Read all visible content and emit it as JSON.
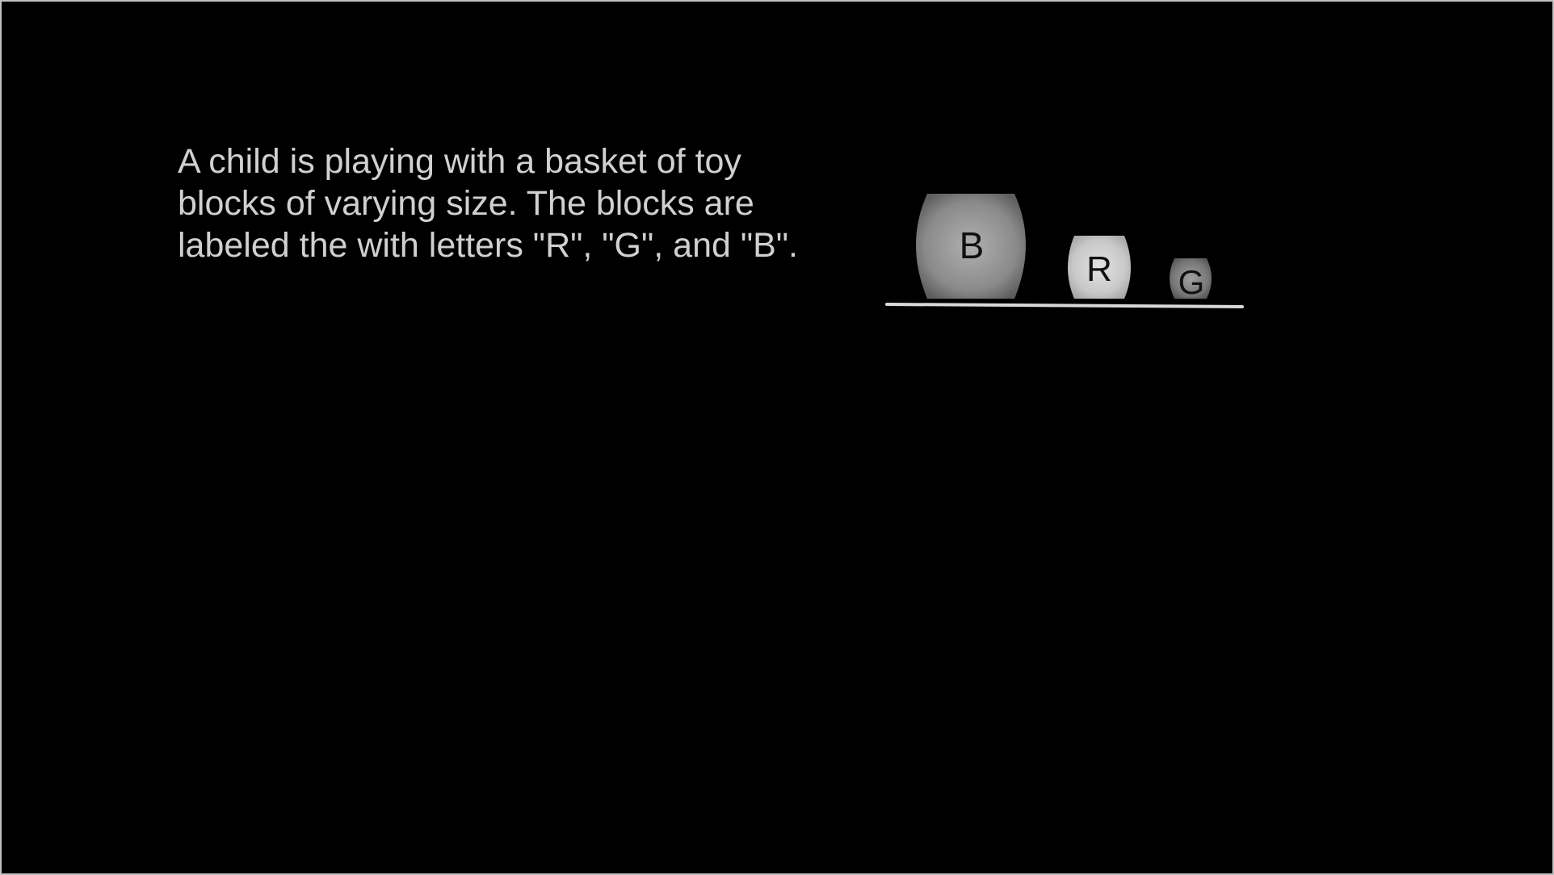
{
  "slide": {
    "text": "A child is playing with a basket of toy\nblocks of varying size. The blocks are\nlabeled the with letters \"R\", \"G\", and \"B\"."
  },
  "blocks": [
    {
      "label": "B",
      "color": "#8a8a8a"
    },
    {
      "label": "R",
      "color": "#c8c8c8"
    },
    {
      "label": "G",
      "color": "#777777"
    }
  ],
  "colors": {
    "background": "#000000",
    "text": "#d0d0d0",
    "ground_line": "#d8d8d8"
  }
}
